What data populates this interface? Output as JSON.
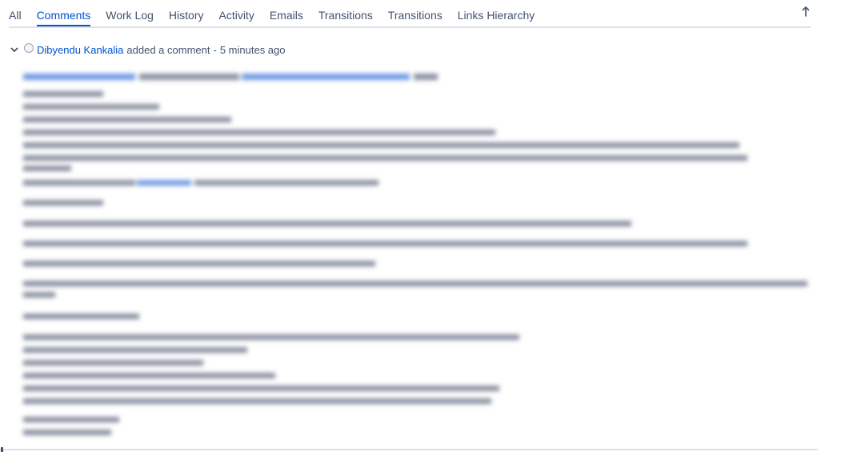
{
  "tabs": [
    {
      "label": "All",
      "active": false
    },
    {
      "label": "Comments",
      "active": true
    },
    {
      "label": "Work Log",
      "active": false
    },
    {
      "label": "History",
      "active": false
    },
    {
      "label": "Activity",
      "active": false
    },
    {
      "label": "Emails",
      "active": false
    },
    {
      "label": "Transitions",
      "active": false
    },
    {
      "label": "Transitions",
      "active": false
    },
    {
      "label": "Links Hierarchy",
      "active": false
    }
  ],
  "comment": {
    "author": "Dibyendu Kankalia",
    "action": "added a comment",
    "separator": "-",
    "time": "5 minutes ago"
  },
  "colors": {
    "accent": "#0052cc",
    "tab_text": "#42526e",
    "divider": "#dfe1e6"
  },
  "icons": {
    "scroll_top": "arrow-up-icon",
    "collapse": "chevron-down-icon",
    "avatar": "avatar-placeholder"
  }
}
